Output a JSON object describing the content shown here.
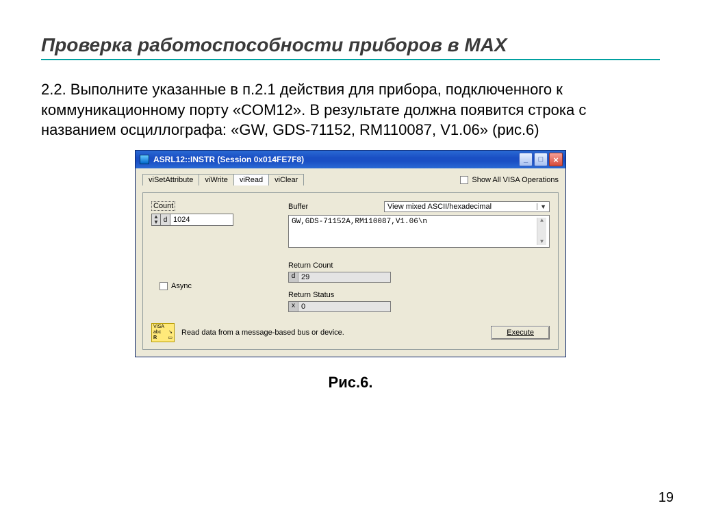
{
  "slide": {
    "title": "Проверка работоспособности  приборов в МАХ",
    "body": "2.2. Выполните указанные в п.2.1 действия для прибора, подключенного к коммуникационному порту «COM12». В результате должна появится строка с названием осциллографа: «GW, GDS-71152, RM110087, V1.06» (рис.6)",
    "caption": "Рис.6.",
    "pageNumber": "19"
  },
  "window": {
    "title": "ASRL12::INSTR (Session 0x014FE7F8)",
    "tabs": [
      "viSetAttribute",
      "viWrite",
      "viRead",
      "viClear"
    ],
    "activeTab": 2,
    "showAll": "Show All VISA Operations",
    "countLabel": "Count",
    "countPrefix": "d",
    "countValue": "1024",
    "bufferLabel": "Buffer",
    "viewMode": "View mixed ASCII/hexadecimal",
    "bufferValue": "GW,GDS-71152A,RM110087,V1.06\\n",
    "async": "Async",
    "returnCountLabel": "Return Count",
    "returnCountPrefix": "d",
    "returnCountValue": "29",
    "returnStatusLabel": "Return Status",
    "returnStatusPrefix": "x",
    "returnStatusValue": "0",
    "footerText": "Read data from a message-based bus or device.",
    "executeLabel": "Execute",
    "visaIcon": {
      "l1": "VISA",
      "l2": "abc",
      "l3": "R"
    }
  }
}
